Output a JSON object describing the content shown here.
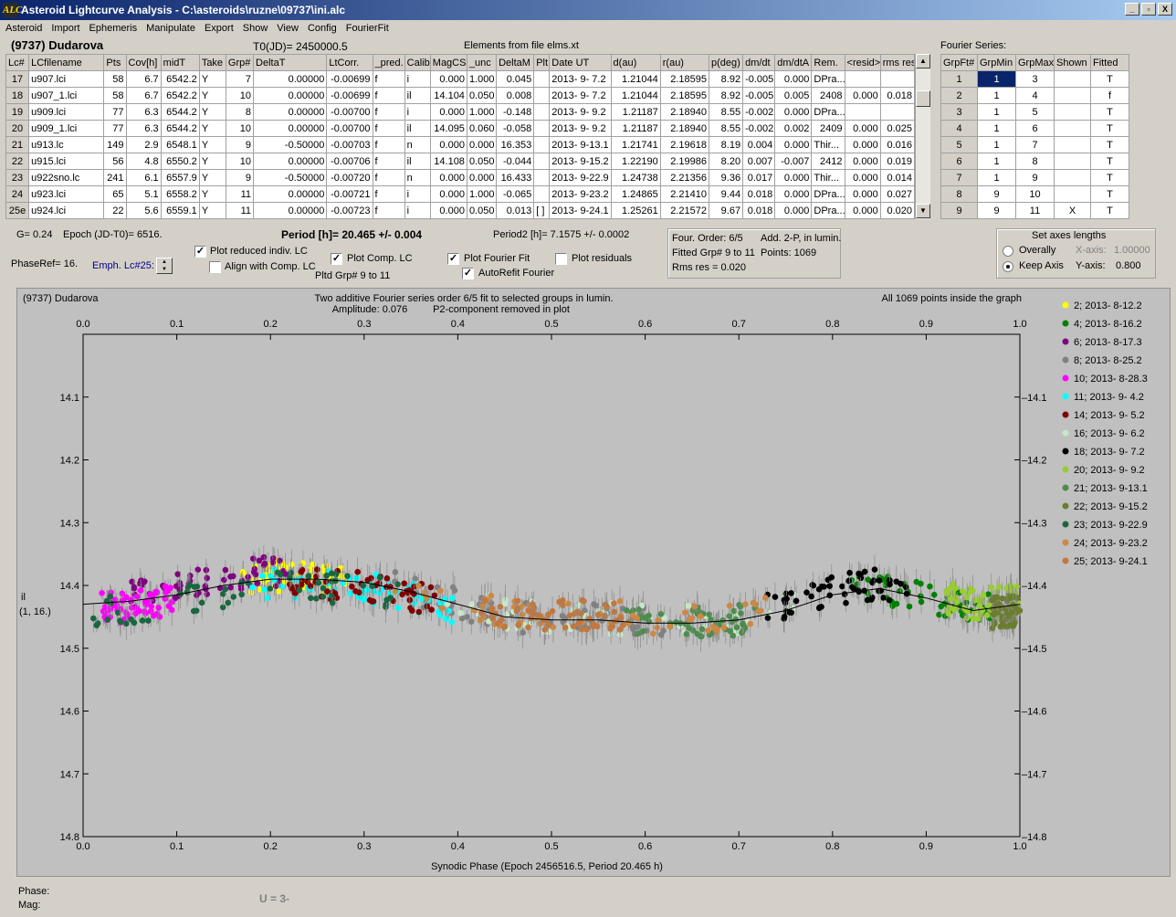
{
  "window": {
    "title": "Asteroid Lightcurve Analysis - C:\\asteroids\\ruzne\\09737\\ini.alc",
    "app_icon": "ALC",
    "controls": [
      "_",
      "▫",
      "X"
    ]
  },
  "menu": [
    "Asteroid",
    "Import",
    "Ephemeris",
    "Manipulate",
    "Export",
    "Show",
    "View",
    "Config",
    "FourierFit"
  ],
  "header": {
    "object": "(9737) Dudarova",
    "t0": "T0(JD)= 2450000.5",
    "elements": "Elements from file elms.xt",
    "fourier_series_label": "Fourier Series:"
  },
  "lc_table": {
    "columns": [
      "Lc#",
      "LCfilename",
      "Pts",
      "Cov[h]",
      "midT",
      "Take",
      "Grp#",
      "DeltaT",
      "LtCorr.",
      "_pred.",
      "Calib.",
      "MagCS",
      "_unc",
      "DeltaM",
      "Plt",
      "Date UT",
      "d(au)",
      "r(au)",
      "p(deg)",
      "dm/dt",
      "dm/dtA",
      "Rem.",
      "<resid>",
      "rms res"
    ],
    "rows": [
      [
        "17",
        "u907.lci",
        "58",
        "6.7",
        "6542.2",
        "Y",
        "7",
        "0.00000",
        "-0.00699",
        "f",
        "i",
        "0.000",
        "1.000",
        "0.045",
        "",
        "2013- 9- 7.2",
        "1.21044",
        "2.18595",
        "8.92",
        "-0.005",
        "0.000",
        "DPra...",
        "",
        ""
      ],
      [
        "18",
        "u907_1.lci",
        "58",
        "6.7",
        "6542.2",
        "Y",
        "10",
        "0.00000",
        "-0.00699",
        "f",
        "il",
        "14.104",
        "0.050",
        "0.008",
        "",
        "2013- 9- 7.2",
        "1.21044",
        "2.18595",
        "8.92",
        "-0.005",
        "0.005",
        "2408",
        "0.000",
        "0.018"
      ],
      [
        "19",
        "u909.lci",
        "77",
        "6.3",
        "6544.2",
        "Y",
        "8",
        "0.00000",
        "-0.00700",
        "f",
        "i",
        "0.000",
        "1.000",
        "-0.148",
        "",
        "2013- 9- 9.2",
        "1.21187",
        "2.18940",
        "8.55",
        "-0.002",
        "0.000",
        "DPra...",
        "",
        ""
      ],
      [
        "20",
        "u909_1.lci",
        "77",
        "6.3",
        "6544.2",
        "Y",
        "10",
        "0.00000",
        "-0.00700",
        "f",
        "il",
        "14.095",
        "0.060",
        "-0.058",
        "",
        "2013- 9- 9.2",
        "1.21187",
        "2.18940",
        "8.55",
        "-0.002",
        "0.002",
        "2409",
        "0.000",
        "0.025"
      ],
      [
        "21",
        "u913.lc",
        "149",
        "2.9",
        "6548.1",
        "Y",
        "9",
        "-0.50000",
        "-0.00703",
        "f",
        "n",
        "0.000",
        "0.000",
        "16.353",
        "",
        "2013- 9-13.1",
        "1.21741",
        "2.19618",
        "8.19",
        "0.004",
        "0.000",
        "Thir...",
        "0.000",
        "0.016"
      ],
      [
        "22",
        "u915.lci",
        "56",
        "4.8",
        "6550.2",
        "Y",
        "10",
        "0.00000",
        "-0.00706",
        "f",
        "il",
        "14.108",
        "0.050",
        "-0.044",
        "",
        "2013- 9-15.2",
        "1.22190",
        "2.19986",
        "8.20",
        "0.007",
        "-0.007",
        "2412",
        "0.000",
        "0.019"
      ],
      [
        "23",
        "u922sno.lc",
        "241",
        "6.1",
        "6557.9",
        "Y",
        "9",
        "-0.50000",
        "-0.00720",
        "f",
        "n",
        "0.000",
        "0.000",
        "16.433",
        "",
        "2013- 9-22.9",
        "1.24738",
        "2.21356",
        "9.36",
        "0.017",
        "0.000",
        "Thir...",
        "0.000",
        "0.014"
      ],
      [
        "24",
        "u923.lci",
        "65",
        "5.1",
        "6558.2",
        "Y",
        "11",
        "0.00000",
        "-0.00721",
        "f",
        "i",
        "0.000",
        "1.000",
        "-0.065",
        "",
        "2013- 9-23.2",
        "1.24865",
        "2.21410",
        "9.44",
        "0.018",
        "0.000",
        "DPra...",
        "0.000",
        "0.027"
      ],
      [
        "25e",
        "u924.lci",
        "22",
        "5.6",
        "6559.1",
        "Y",
        "11",
        "0.00000",
        "-0.00723",
        "f",
        "i",
        "0.000",
        "0.050",
        "0.013",
        "[ ]",
        "2013- 9-24.1",
        "1.25261",
        "2.21572",
        "9.67",
        "0.018",
        "0.000",
        "DPra...",
        "0.000",
        "0.020"
      ]
    ]
  },
  "fourier_table": {
    "columns": [
      "GrpFt#",
      "GrpMin",
      "GrpMax",
      "Shown",
      "Fitted"
    ],
    "rows": [
      [
        "1",
        "1",
        "3",
        "",
        "T"
      ],
      [
        "2",
        "1",
        "4",
        "",
        "f"
      ],
      [
        "3",
        "1",
        "5",
        "",
        "T"
      ],
      [
        "4",
        "1",
        "6",
        "",
        "T"
      ],
      [
        "5",
        "1",
        "7",
        "",
        "T"
      ],
      [
        "6",
        "1",
        "8",
        "",
        "T"
      ],
      [
        "7",
        "1",
        "9",
        "",
        "T"
      ],
      [
        "8",
        "9",
        "10",
        "",
        "T"
      ],
      [
        "9",
        "9",
        "11",
        "X",
        "T"
      ]
    ]
  },
  "params": {
    "g": "G= 0.24",
    "epoch": "Epoch (JD-T0)= 6516.",
    "phaseref": "PhaseRef= 16.",
    "emph": "Emph. Lc#25:",
    "period": "Period [h]= 20.465 +/- 0.004",
    "period2": "Period2 [h]= 7.1575 +/- 0.0002",
    "pltd_grp": "Pltd Grp#  9  to  11"
  },
  "checkboxes": {
    "plot_reduced": {
      "label": "Plot reduced indiv. LC",
      "checked": "✓"
    },
    "align_comp": {
      "label": "Align with Comp. LC",
      "checked": ""
    },
    "plot_comp": {
      "label": "Plot Comp. LC",
      "checked": "✓"
    },
    "plot_fourier": {
      "label": "Plot Fourier Fit",
      "checked": "✓"
    },
    "plot_residuals": {
      "label": "Plot residuals",
      "checked": ""
    },
    "autorefit": {
      "label": "AutoRefit Fourier",
      "checked": "✓"
    }
  },
  "fit_info": {
    "order": "Four. Order:  6/5",
    "add": "Add. 2-P, in lumin.",
    "fitted": "Fitted Grp# 9 to 11",
    "points": "Points: 1069",
    "rms": "Rms res     = 0.020"
  },
  "axes_box": {
    "title": "Set axes lengths",
    "overall": "Overally",
    "keep": "Keep Axis",
    "xaxis_label": "X-axis:",
    "xaxis_value": "1.00000",
    "yaxis_label": "Y-axis:",
    "yaxis_value": "0.800"
  },
  "plot": {
    "object": "(9737) Dudarova",
    "subtitle1": "Two additive Fourier series order 6/5 fit to selected groups in lumin.",
    "subtitle2": "Amplitude: 0.076",
    "subtitle3": "P2-component removed in plot",
    "points_note": "All 1069 points inside the graph",
    "ylabel1": "il",
    "ylabel2": "(1, 16.)",
    "xlabel": "Synodic Phase (Epoch 2456516.5, Period 20.465 h)"
  },
  "chart_data": {
    "type": "scatter",
    "x_ticks": [
      "0.0",
      "0.1",
      "0.2",
      "0.3",
      "0.4",
      "0.5",
      "0.6",
      "0.7",
      "0.8",
      "0.9",
      "1.0"
    ],
    "y_ticks": [
      "14.1",
      "14.2",
      "14.3",
      "14.4",
      "14.5",
      "14.6",
      "14.7",
      "14.8"
    ],
    "xlim": [
      0,
      1
    ],
    "ylim": [
      14.0,
      14.8
    ],
    "y_inverted": true,
    "fit_curve": [
      [
        0,
        14.43
      ],
      [
        0.05,
        14.425
      ],
      [
        0.1,
        14.415
      ],
      [
        0.15,
        14.4
      ],
      [
        0.2,
        14.39
      ],
      [
        0.25,
        14.39
      ],
      [
        0.3,
        14.395
      ],
      [
        0.35,
        14.41
      ],
      [
        0.4,
        14.43
      ],
      [
        0.45,
        14.45
      ],
      [
        0.5,
        14.455
      ],
      [
        0.55,
        14.455
      ],
      [
        0.6,
        14.46
      ],
      [
        0.65,
        14.46
      ],
      [
        0.7,
        14.455
      ],
      [
        0.75,
        14.44
      ],
      [
        0.8,
        14.415
      ],
      [
        0.85,
        14.405
      ],
      [
        0.9,
        14.42
      ],
      [
        0.95,
        14.44
      ],
      [
        1.0,
        14.43
      ]
    ],
    "series": [
      {
        "name": "2; 2013- 8-12.2",
        "color": "#ffff00",
        "range": [
          0.17,
          0.28
        ],
        "mean": 14.38
      },
      {
        "name": "4; 2013- 8-16.2",
        "color": "#008000",
        "range": [
          0.82,
          0.97
        ],
        "mean": 14.42
      },
      {
        "name": "6; 2013- 8-17.3",
        "color": "#800080",
        "range": [
          0.05,
          0.22
        ],
        "mean": 14.38
      },
      {
        "name": "8; 2013- 8-25.2",
        "color": "#808080",
        "range": [
          0.33,
          0.62
        ],
        "mean": 14.45
      },
      {
        "name": "10; 2013- 8-28.3",
        "color": "#ff00ff",
        "range": [
          0.02,
          0.1
        ],
        "mean": 14.44
      },
      {
        "name": "11; 2013- 9- 4.2",
        "color": "#00ffff",
        "range": [
          0.18,
          0.4
        ],
        "mean": 14.41
      },
      {
        "name": "14; 2013- 9- 5.2",
        "color": "#800000",
        "range": [
          0.22,
          0.38
        ],
        "mean": 14.41
      },
      {
        "name": "16; 2013- 9- 6.2",
        "color": "#c8e6c8",
        "range": [
          0.38,
          0.76
        ],
        "mean": 14.45
      },
      {
        "name": "18; 2013- 9- 7.2",
        "color": "#000000",
        "range": [
          0.73,
          0.88
        ],
        "mean": 14.4
      },
      {
        "name": "20; 2013- 9- 9.2",
        "color": "#99cc33",
        "range": [
          0.92,
          1.0
        ],
        "mean": 14.42
      },
      {
        "name": "21; 2013- 9-13.1",
        "color": "#4c8c4c",
        "range": [
          0.58,
          0.72
        ],
        "mean": 14.46
      },
      {
        "name": "22; 2013- 9-15.2",
        "color": "#6b7d2f",
        "range": [
          0.97,
          1.0
        ],
        "mean": 14.45
      },
      {
        "name": "23; 2013- 9-22.9",
        "color": "#1a6640",
        "range": [
          0.0,
          0.34
        ],
        "mean": 14.42
      },
      {
        "name": "24; 2013- 9-23.2",
        "color": "#cc8844",
        "range": [
          0.33,
          0.73
        ],
        "mean": 14.44
      },
      {
        "name": "25; 2013- 9-24.1",
        "color": "#c07840",
        "range": [
          0.42,
          0.58
        ],
        "mean": 14.44
      }
    ]
  },
  "status": {
    "phase": "Phase:",
    "mag": "Mag:",
    "u": "U = 3-"
  }
}
